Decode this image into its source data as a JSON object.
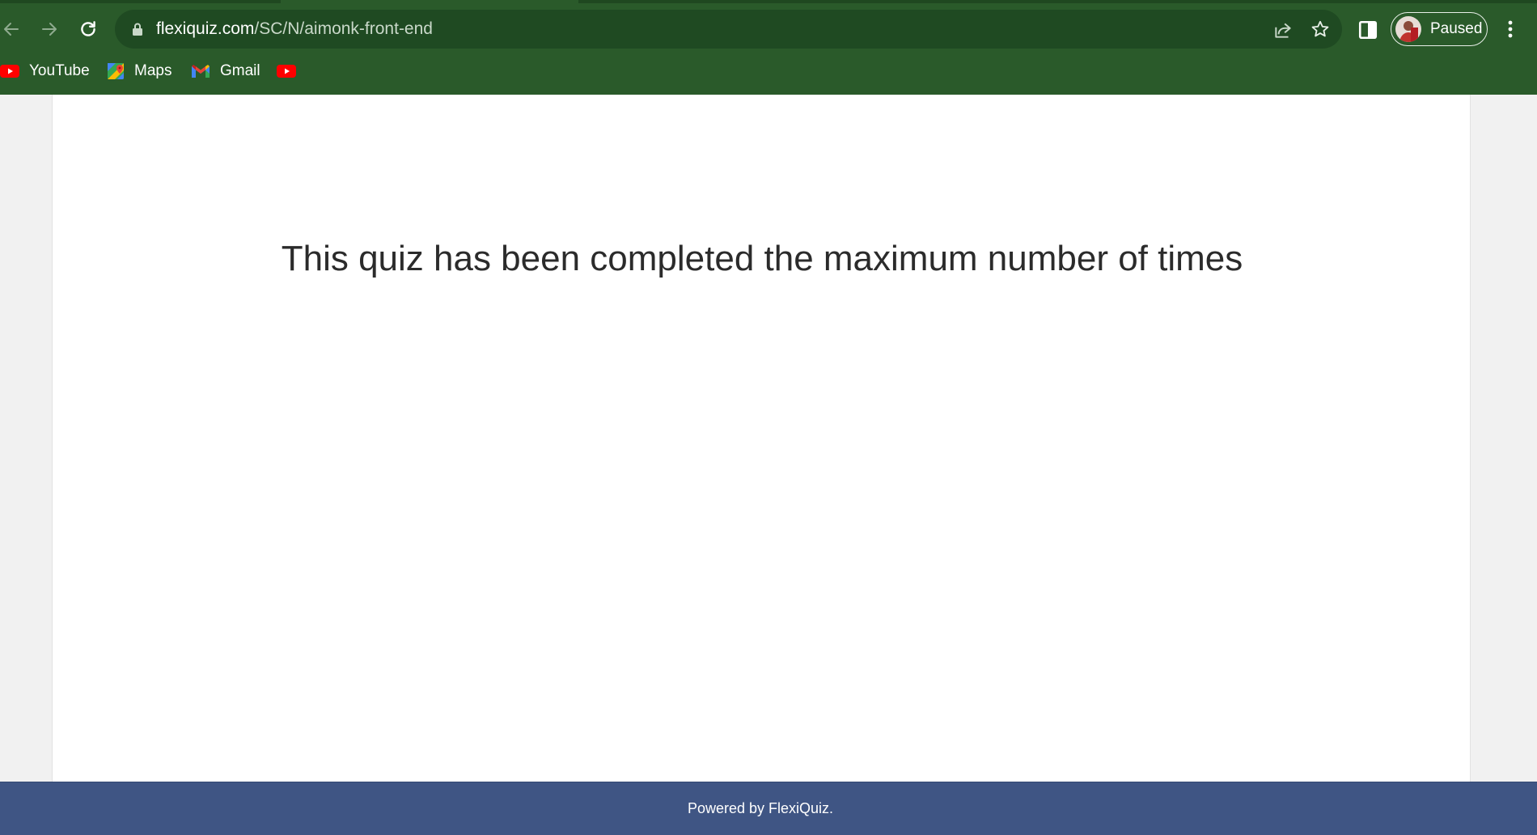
{
  "browser": {
    "url_host": "flexiquiz.com",
    "url_path": "/SC/N/aimonk-front-end",
    "profile_status": "Paused",
    "theme_color": "#2a5a2a",
    "bookmarks": [
      {
        "label": "YouTube",
        "icon": "youtube-icon"
      },
      {
        "label": "Maps",
        "icon": "maps-icon"
      },
      {
        "label": "Gmail",
        "icon": "gmail-icon"
      },
      {
        "label": "",
        "icon": "youtube-icon"
      }
    ]
  },
  "page": {
    "message": "This quiz has been completed the maximum number of times",
    "footer_text": "Powered by FlexiQuiz.",
    "footer_color": "#3f5584"
  }
}
